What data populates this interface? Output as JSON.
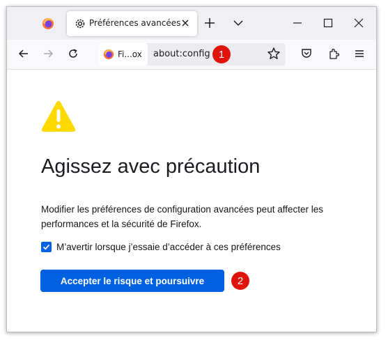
{
  "tab": {
    "title": "Préférences avancées"
  },
  "navbar": {
    "identity_label": "Fi...ox",
    "url": "about:config"
  },
  "annotations": {
    "badge1": "1",
    "badge2": "2"
  },
  "content": {
    "title": "Agissez avec précaution",
    "description": "Modifier les préférences de configuration avancées peut affecter les performances et la sécurité de Firefox.",
    "checkbox_label": "M’avertir lorsque j’essaie d’accéder à ces préférences",
    "checkbox_checked": true,
    "accept_button": "Accepter le risque et poursuivre"
  },
  "colors": {
    "accent": "#0061e0",
    "warning": "#ffd900",
    "badge": "#e0140d"
  },
  "icons": [
    "firefox-icon",
    "gear-icon",
    "close-icon",
    "plus-icon",
    "chevron-down-icon",
    "minimize-icon",
    "maximize-icon",
    "back-icon",
    "forward-icon",
    "reload-icon",
    "star-icon",
    "pocket-icon",
    "extensions-icon",
    "menu-icon",
    "warning-icon",
    "checkmark-icon"
  ]
}
